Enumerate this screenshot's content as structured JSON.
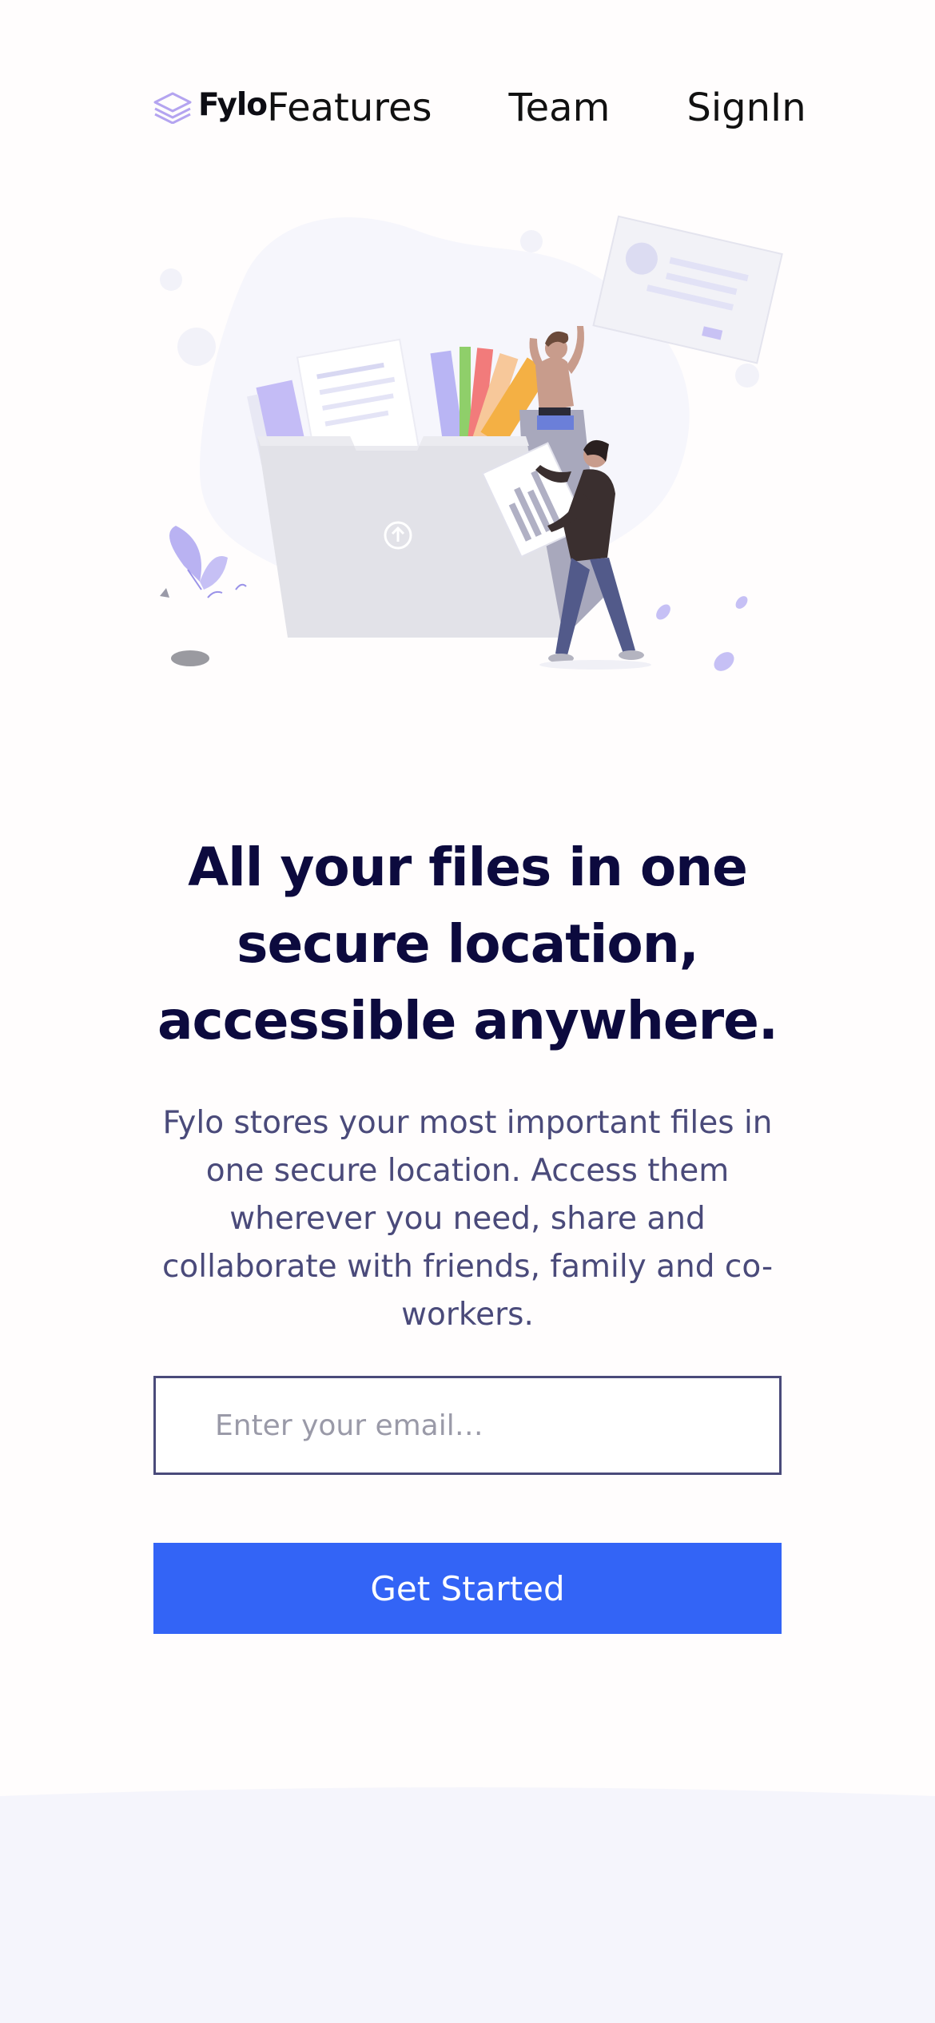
{
  "brand": {
    "name": "Fylo",
    "logo_icon": "stacked-layers-icon",
    "accent_color": "#b4a4f0"
  },
  "nav": {
    "features": "Features",
    "team": "Team",
    "signin": "SignIn"
  },
  "hero": {
    "headline": "All your files in one secure location, accessible anywhere.",
    "description": "Fylo stores your most important files in one secure location. Access them wherever you need, share and collaborate with friends, family and co-workers."
  },
  "form": {
    "email_placeholder": "Enter your email…",
    "email_value": "",
    "cta_label": "Get Started",
    "cta_color": "#3364f6"
  },
  "colors": {
    "headline": "#0c0a3e",
    "body_text": "#4a4a7a",
    "page_background": "#fffdfd",
    "footer_background": "#f5f5fc"
  }
}
